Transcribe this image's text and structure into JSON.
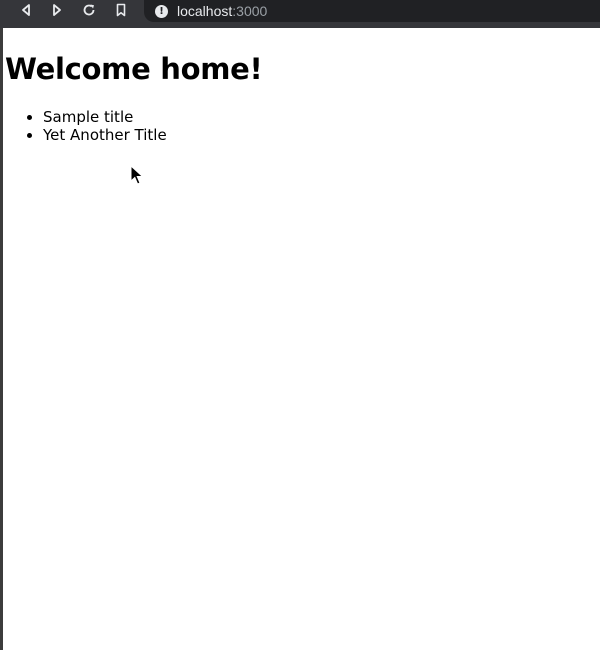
{
  "browser": {
    "url_host": "localhost",
    "url_port": ":3000",
    "icons": {
      "back": "back-arrow-icon",
      "forward": "forward-arrow-icon",
      "reload": "reload-icon",
      "bookmark": "bookmark-icon",
      "site_info": "info-icon"
    },
    "colors": {
      "toolbar": "#35363a",
      "address_bar": "#202124",
      "url_text": "#e8eaed",
      "url_port_text": "#9aa0a6"
    }
  },
  "page": {
    "heading": "Welcome home!",
    "items": [
      {
        "label": "Sample title"
      },
      {
        "label": "Yet Another Title"
      }
    ]
  }
}
